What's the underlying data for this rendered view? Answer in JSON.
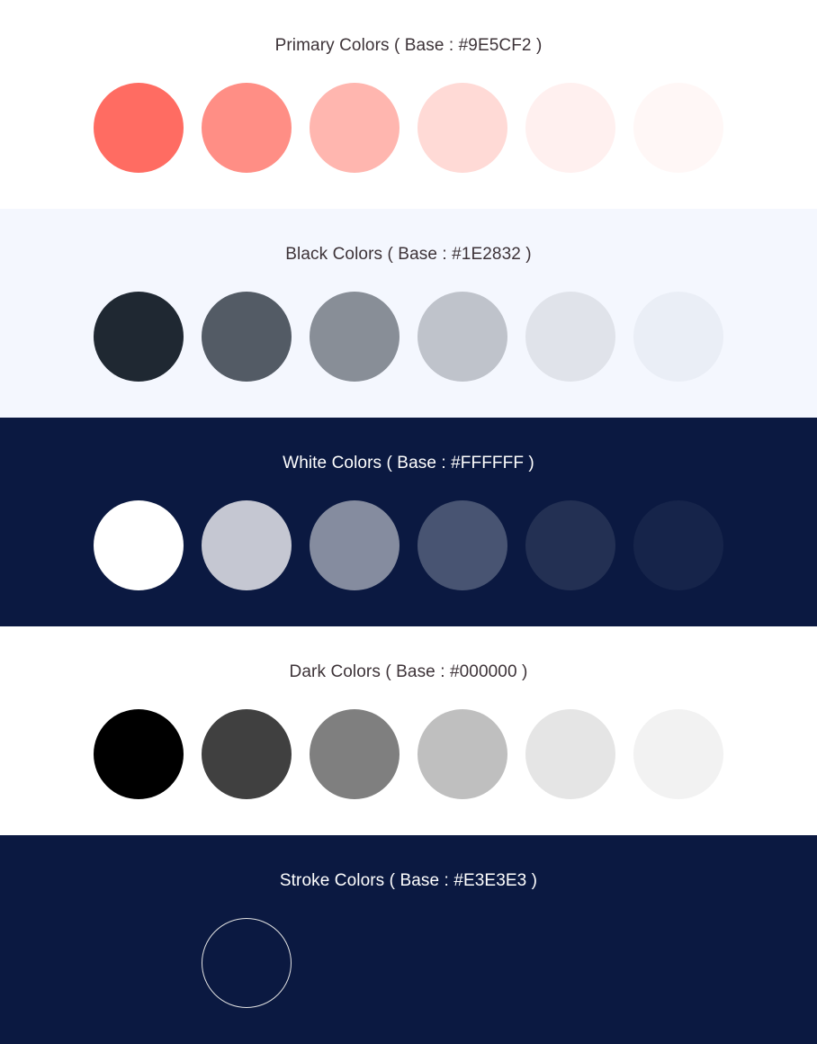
{
  "sections": [
    {
      "title": "Primary Colors ( Base : #9E5CF2 )",
      "background": "#FFFFFF",
      "title_color": "#3D3338",
      "swatches": [
        "#FF6C62",
        "#FF8E85",
        "#FFB6AF",
        "#FFDAD6",
        "#FFF0EF",
        "#FFF7F6"
      ]
    },
    {
      "title": "Black Colors ( Base : #1E2832 )",
      "background": "#F4F7FE",
      "title_color": "#3D3338",
      "swatches": [
        "#1F2832",
        "#535B65",
        "#888E97",
        "#BFC3CB",
        "#E0E3EA",
        "#EAEEF6"
      ]
    },
    {
      "title": "White Colors ( Base : #FFFFFF )",
      "background": "#0B1941",
      "title_color": "#FFFFFF",
      "swatches": [
        "#FFFFFF",
        "#C5C7D2",
        "#858C9F",
        "#485472",
        "#233053",
        "#16244A"
      ]
    },
    {
      "title": "Dark Colors ( Base : #000000 )",
      "background": "#FFFFFF",
      "title_color": "#3D3338",
      "swatches": [
        "#000000",
        "#404040",
        "#7F7F7F",
        "#BFBFBF",
        "#E5E5E5",
        "#F2F2F2"
      ]
    },
    {
      "title": "Stroke Colors ( Base : #E3E3E3 )",
      "background": "#0B1941",
      "title_color": "#FFFFFF",
      "stroke_color": "#E3E3E3",
      "swatches": []
    }
  ]
}
